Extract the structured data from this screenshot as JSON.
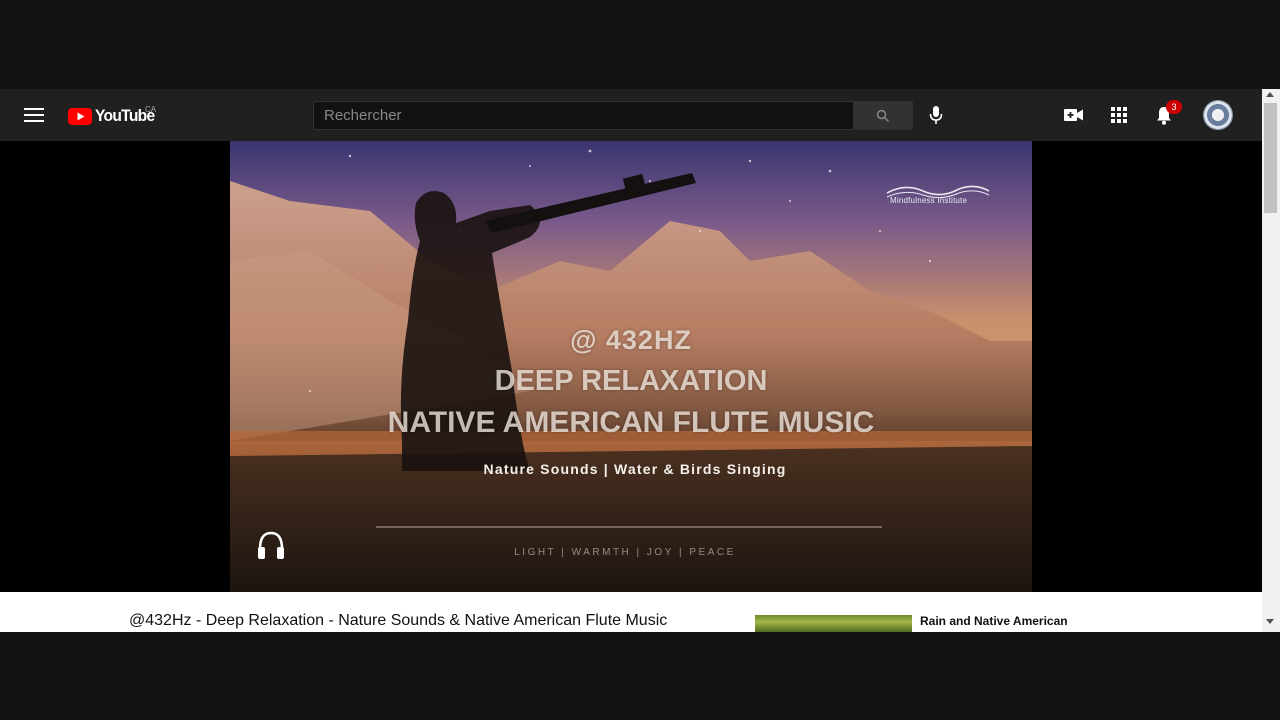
{
  "masthead": {
    "logo_text": "YouTube",
    "country_code": "CA",
    "search_placeholder": "Rechercher",
    "notification_count": "3",
    "icons": [
      "menu-icon",
      "search-icon",
      "microphone-icon",
      "create-video-icon",
      "apps-grid-icon",
      "notifications-bell-icon"
    ]
  },
  "video": {
    "watermark": "Mindfulness Institute",
    "line_hz": "@ 432HZ",
    "line_deep": "DEEP RELAXATION",
    "line_native": "NATIVE AMERICAN FLUTE MUSIC",
    "subtitle": "Nature Sounds | Water & Birds Singing",
    "tags": "LIGHT | WARMTH | JOY | PEACE"
  },
  "watch": {
    "title": "@432Hz - Deep Relaxation - Nature Sounds & Native American Flute Music"
  },
  "recommendations": [
    {
      "title": "Rain and Native American"
    }
  ],
  "colors": {
    "masthead_bg": "#202020",
    "youtube_red": "#ff0000",
    "badge_red": "#cc0000"
  }
}
